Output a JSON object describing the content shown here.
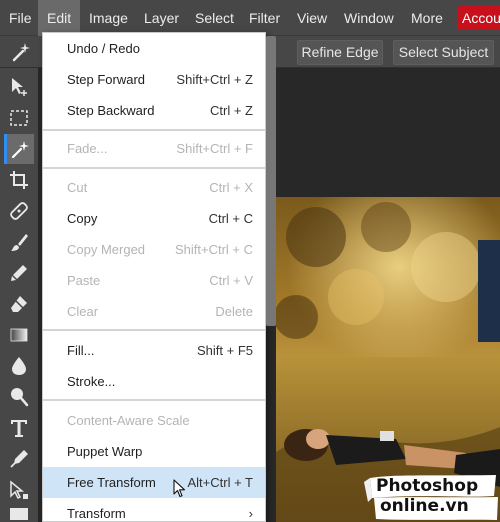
{
  "menubar": {
    "items": [
      {
        "label": "File"
      },
      {
        "label": "Edit",
        "active": true
      },
      {
        "label": "Image"
      },
      {
        "label": "Layer"
      },
      {
        "label": "Select"
      },
      {
        "label": "Filter"
      },
      {
        "label": "View"
      },
      {
        "label": "Window"
      },
      {
        "label": "More"
      }
    ],
    "account_label": "Account"
  },
  "options_bar": {
    "refine_edge_label": "Refine Edge",
    "select_subject_label": "Select Subject"
  },
  "toolbar": {
    "tools": [
      {
        "icon": "move-icon"
      },
      {
        "icon": "marquee-icon"
      },
      {
        "icon": "magic-wand-icon",
        "active": true
      },
      {
        "icon": "crop-icon"
      },
      {
        "icon": "healing-icon"
      },
      {
        "icon": "brush-icon"
      },
      {
        "icon": "clone-stamp-icon"
      },
      {
        "icon": "eraser-icon"
      },
      {
        "icon": "gradient-icon"
      },
      {
        "icon": "blur-icon"
      },
      {
        "icon": "dodge-icon"
      },
      {
        "icon": "type-icon"
      },
      {
        "icon": "pen-icon"
      },
      {
        "icon": "path-select-icon"
      },
      {
        "icon": "rectangle-icon"
      }
    ]
  },
  "edit_menu": {
    "items": [
      {
        "label": "Undo / Redo",
        "shortcut": ""
      },
      {
        "label": "Step Forward",
        "shortcut": "Shift+Ctrl + Z"
      },
      {
        "label": "Step Backward",
        "shortcut": "Ctrl + Z"
      },
      {
        "label": "Fade...",
        "shortcut": "Shift+Ctrl + F",
        "disabled": true
      },
      {
        "label": "Cut",
        "shortcut": "Ctrl + X",
        "disabled": true
      },
      {
        "label": "Copy",
        "shortcut": "Ctrl + C"
      },
      {
        "label": "Copy Merged",
        "shortcut": "Shift+Ctrl + C",
        "disabled": true
      },
      {
        "label": "Paste",
        "shortcut": "Ctrl + V",
        "disabled": true
      },
      {
        "label": "Clear",
        "shortcut": "Delete",
        "disabled": true
      },
      {
        "label": "Fill...",
        "shortcut": "Shift + F5"
      },
      {
        "label": "Stroke...",
        "shortcut": ""
      },
      {
        "label": "Content-Aware Scale",
        "shortcut": "",
        "disabled": true
      },
      {
        "label": "Puppet Warp",
        "shortcut": ""
      },
      {
        "label": "Free Transform",
        "shortcut": "Alt+Ctrl + T",
        "hovered": true
      },
      {
        "label": "Transform",
        "shortcut": ""
      }
    ]
  },
  "watermark": {
    "line1": "Photoshop",
    "line2": "online.vn"
  },
  "colors": {
    "accent_blue": "#2f8ff0",
    "account_red": "#c8101d",
    "menu_hover": "#cfe4f7"
  }
}
